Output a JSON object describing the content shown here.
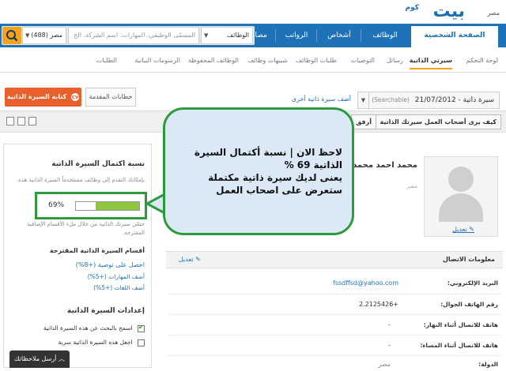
{
  "header": {
    "logo_main": "بيت",
    "logo_sub": "كوم",
    "country": "مصر"
  },
  "nav": {
    "tabs": [
      "الصفحة الشخصية",
      "الوظائف",
      "أشخاص",
      "الرواتب",
      "مصادر"
    ],
    "active": "الصفحة الشخصية"
  },
  "search": {
    "category": "الوظائف",
    "placeholder": "المسمّى الوظيفي، المهارات، اسم الشركة، الخ",
    "location": "مصر (488)"
  },
  "subnav": {
    "items": [
      "لوحة التحكم",
      "سيرتي الذاتية",
      "رسائل",
      "التوصيات",
      "طلبات الوظائف",
      "شبيهات وظائف",
      "الوظائف المحفوظة",
      "الرسومات البيانية",
      "الطلبات"
    ],
    "active": "سيرتي الذاتية"
  },
  "cv_toolbar": {
    "selected_cv": "سيرة ذاتية - 21/07/2012",
    "searchable": "(Searchable)",
    "add_cv_link": "أضف سيرة ذاتية أخرى",
    "write_cv_button": "كتابة السيرة الذاتية",
    "advanced_letters_button": "خطابات المقدمة",
    "how_employers_see": "كيف يرى أصحاب العمل سيرتك الذاتية",
    "attach": "أرفق"
  },
  "sidebar": {
    "completeness_title": "نسبة اكتمال السيرة الذاتية",
    "completeness_desc": "بإمكانك التقدم إلى وظائف مستخدماً السيرة الذاتية هذه.",
    "completeness_percent": 69,
    "completeness_label": "69%",
    "improve_text": "حسّن سيرتك الذاتية من خلال ملء الأقسام الإضافية المقترحة.",
    "suggested_title": "أقسام السيرة الذاتية المقترحة",
    "suggested": [
      "احصل على توصية (+8%)",
      "أضف المهارات (+5%)",
      "أضف اللغات (+5%)"
    ],
    "settings_title": "إعدادات السيرة الذاتية",
    "settings": [
      {
        "label": "اسمح بالبحث عن هذه السيرة الذاتية",
        "checked": true
      },
      {
        "label": "اجعل هذه السيرة الذاتية سرية",
        "checked": false
      }
    ],
    "feedback_button": "أرسل ملاحظاتك"
  },
  "profile": {
    "name": "محمد احمد محمد",
    "location": "مصر",
    "edit_photo": "تعديل",
    "contact_title": "معلومات الاتصال",
    "contact_edit": "تعديل",
    "contact_rows": [
      {
        "label": "البريد الإلكتروني:",
        "value": "fssdffsd@yahoo.com"
      },
      {
        "label": "رقم الهاتف الجوال:",
        "value": "+2.2125426"
      },
      {
        "label": "هاتف للاتصال أثناء النهار:",
        "value": "-"
      },
      {
        "label": "هاتف للاتصال أثناء المساء:",
        "value": "-"
      },
      {
        "label": "الدولة:",
        "value": "مصر"
      }
    ]
  },
  "callout": {
    "lines": [
      "لاحظ الان | نسبة أكتمال السيرة",
      "الذاتية 69 %",
      "يعنى لديك سيرة ذاتية مكتملة",
      "ستعرض على اصحاب العمل"
    ]
  },
  "colors": {
    "brand_blue": "#1f72b8",
    "accent_orange": "#e8612c",
    "search_orange": "#f7a21b",
    "highlight_green": "#2e9a3e",
    "progress_green": "#8dc63f",
    "callout_bg": "#dbe8f5"
  }
}
